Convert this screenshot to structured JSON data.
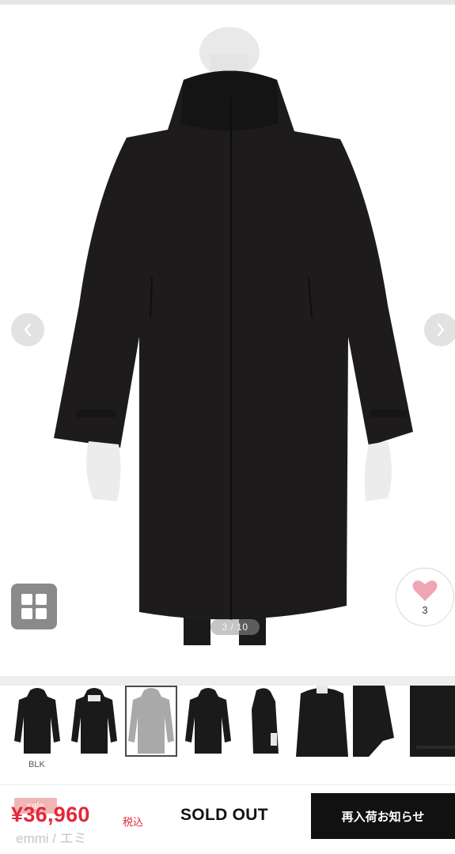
{
  "gallery": {
    "page_indicator": "3 / 10",
    "favorite_count": "3",
    "thumbnails": [
      {
        "label": "BLK",
        "selected": false,
        "style": "front-hooded-coat"
      },
      {
        "label": "",
        "selected": false,
        "style": "front-hooded-coat-open"
      },
      {
        "label": "",
        "selected": true,
        "style": "grey-fabric-coat"
      },
      {
        "label": "",
        "selected": false,
        "style": "front-hooded-coat"
      },
      {
        "label": "",
        "selected": false,
        "style": "side-view-coat"
      },
      {
        "label": "",
        "selected": false,
        "style": "hood-detail"
      },
      {
        "label": "",
        "selected": false,
        "style": "sleeve-detail"
      },
      {
        "label": "",
        "selected": false,
        "style": "hem-detail"
      }
    ],
    "icons": {
      "prev": "chevron-left-icon",
      "next": "chevron-right-icon",
      "grid": "grid-icon",
      "favorite": "heart-icon"
    }
  },
  "purchase": {
    "sale_badge": "sale",
    "price": "¥36,960",
    "tax_label": "税込",
    "brand": "emmi / エミ",
    "status": "SOLD OUT",
    "restock_button": "再入荷お知らせ"
  },
  "colors": {
    "price_red": "#e2283a",
    "heart_pink": "#f0a6b2",
    "coat_black": "#1d1b1c",
    "button_black": "#111111"
  }
}
